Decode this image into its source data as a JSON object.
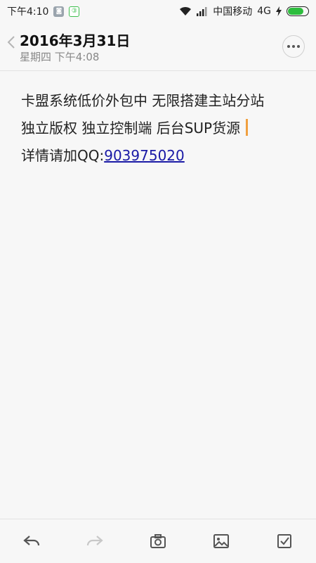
{
  "status_bar": {
    "time": "下午4:10",
    "carrier": "中国移动",
    "network": "4G",
    "battery_level": 0.8,
    "icons": [
      "notification-app-icon",
      "notification-green-icon",
      "wifi-icon",
      "signal-icon",
      "charging-icon",
      "battery-icon"
    ]
  },
  "header": {
    "date": "2016年3月31日",
    "weekday_time": "星期四 下午4:08"
  },
  "message": {
    "line1": "卡盟系统低价外包中  无限搭建主站分站",
    "line2": "独立版权  独立控制端  后台SUP货源 ",
    "line3_prefix": "详情请加QQ:",
    "qq_number": "903975020"
  },
  "toolbar": {
    "icons": [
      "reply-icon",
      "forward-icon",
      "camera-icon",
      "image-icon",
      "checkbox-icon"
    ]
  },
  "colors": {
    "link": "#1a1aa6",
    "cursor": "#f0a040",
    "battery": "#2dbd3d"
  }
}
